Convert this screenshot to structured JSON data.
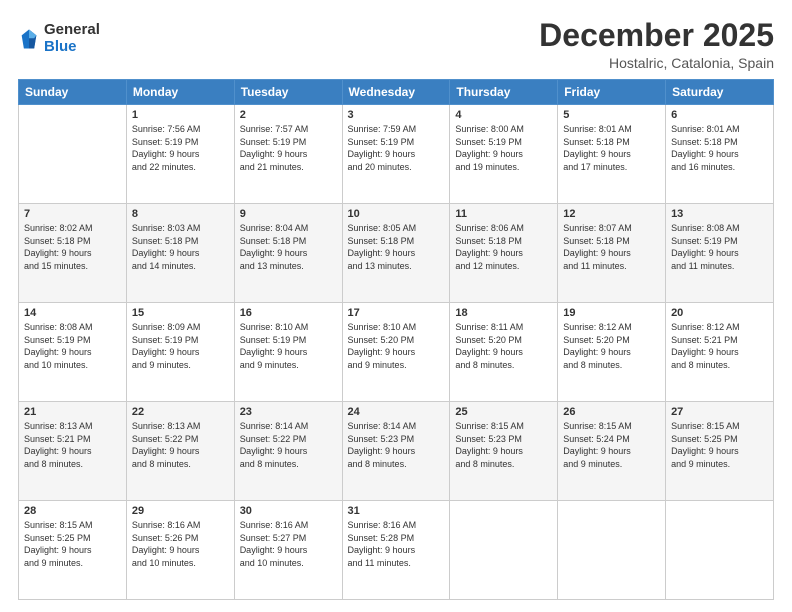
{
  "logo": {
    "line1": "General",
    "line2": "Blue"
  },
  "header": {
    "month": "December 2025",
    "location": "Hostalric, Catalonia, Spain"
  },
  "weekdays": [
    "Sunday",
    "Monday",
    "Tuesday",
    "Wednesday",
    "Thursday",
    "Friday",
    "Saturday"
  ],
  "weeks": [
    [
      {
        "day": "",
        "info": ""
      },
      {
        "day": "1",
        "info": "Sunrise: 7:56 AM\nSunset: 5:19 PM\nDaylight: 9 hours\nand 22 minutes."
      },
      {
        "day": "2",
        "info": "Sunrise: 7:57 AM\nSunset: 5:19 PM\nDaylight: 9 hours\nand 21 minutes."
      },
      {
        "day": "3",
        "info": "Sunrise: 7:59 AM\nSunset: 5:19 PM\nDaylight: 9 hours\nand 20 minutes."
      },
      {
        "day": "4",
        "info": "Sunrise: 8:00 AM\nSunset: 5:19 PM\nDaylight: 9 hours\nand 19 minutes."
      },
      {
        "day": "5",
        "info": "Sunrise: 8:01 AM\nSunset: 5:18 PM\nDaylight: 9 hours\nand 17 minutes."
      },
      {
        "day": "6",
        "info": "Sunrise: 8:01 AM\nSunset: 5:18 PM\nDaylight: 9 hours\nand 16 minutes."
      }
    ],
    [
      {
        "day": "7",
        "info": "Sunrise: 8:02 AM\nSunset: 5:18 PM\nDaylight: 9 hours\nand 15 minutes."
      },
      {
        "day": "8",
        "info": "Sunrise: 8:03 AM\nSunset: 5:18 PM\nDaylight: 9 hours\nand 14 minutes."
      },
      {
        "day": "9",
        "info": "Sunrise: 8:04 AM\nSunset: 5:18 PM\nDaylight: 9 hours\nand 13 minutes."
      },
      {
        "day": "10",
        "info": "Sunrise: 8:05 AM\nSunset: 5:18 PM\nDaylight: 9 hours\nand 13 minutes."
      },
      {
        "day": "11",
        "info": "Sunrise: 8:06 AM\nSunset: 5:18 PM\nDaylight: 9 hours\nand 12 minutes."
      },
      {
        "day": "12",
        "info": "Sunrise: 8:07 AM\nSunset: 5:18 PM\nDaylight: 9 hours\nand 11 minutes."
      },
      {
        "day": "13",
        "info": "Sunrise: 8:08 AM\nSunset: 5:19 PM\nDaylight: 9 hours\nand 11 minutes."
      }
    ],
    [
      {
        "day": "14",
        "info": "Sunrise: 8:08 AM\nSunset: 5:19 PM\nDaylight: 9 hours\nand 10 minutes."
      },
      {
        "day": "15",
        "info": "Sunrise: 8:09 AM\nSunset: 5:19 PM\nDaylight: 9 hours\nand 9 minutes."
      },
      {
        "day": "16",
        "info": "Sunrise: 8:10 AM\nSunset: 5:19 PM\nDaylight: 9 hours\nand 9 minutes."
      },
      {
        "day": "17",
        "info": "Sunrise: 8:10 AM\nSunset: 5:20 PM\nDaylight: 9 hours\nand 9 minutes."
      },
      {
        "day": "18",
        "info": "Sunrise: 8:11 AM\nSunset: 5:20 PM\nDaylight: 9 hours\nand 8 minutes."
      },
      {
        "day": "19",
        "info": "Sunrise: 8:12 AM\nSunset: 5:20 PM\nDaylight: 9 hours\nand 8 minutes."
      },
      {
        "day": "20",
        "info": "Sunrise: 8:12 AM\nSunset: 5:21 PM\nDaylight: 9 hours\nand 8 minutes."
      }
    ],
    [
      {
        "day": "21",
        "info": "Sunrise: 8:13 AM\nSunset: 5:21 PM\nDaylight: 9 hours\nand 8 minutes."
      },
      {
        "day": "22",
        "info": "Sunrise: 8:13 AM\nSunset: 5:22 PM\nDaylight: 9 hours\nand 8 minutes."
      },
      {
        "day": "23",
        "info": "Sunrise: 8:14 AM\nSunset: 5:22 PM\nDaylight: 9 hours\nand 8 minutes."
      },
      {
        "day": "24",
        "info": "Sunrise: 8:14 AM\nSunset: 5:23 PM\nDaylight: 9 hours\nand 8 minutes."
      },
      {
        "day": "25",
        "info": "Sunrise: 8:15 AM\nSunset: 5:23 PM\nDaylight: 9 hours\nand 8 minutes."
      },
      {
        "day": "26",
        "info": "Sunrise: 8:15 AM\nSunset: 5:24 PM\nDaylight: 9 hours\nand 9 minutes."
      },
      {
        "day": "27",
        "info": "Sunrise: 8:15 AM\nSunset: 5:25 PM\nDaylight: 9 hours\nand 9 minutes."
      }
    ],
    [
      {
        "day": "28",
        "info": "Sunrise: 8:15 AM\nSunset: 5:25 PM\nDaylight: 9 hours\nand 9 minutes."
      },
      {
        "day": "29",
        "info": "Sunrise: 8:16 AM\nSunset: 5:26 PM\nDaylight: 9 hours\nand 10 minutes."
      },
      {
        "day": "30",
        "info": "Sunrise: 8:16 AM\nSunset: 5:27 PM\nDaylight: 9 hours\nand 10 minutes."
      },
      {
        "day": "31",
        "info": "Sunrise: 8:16 AM\nSunset: 5:28 PM\nDaylight: 9 hours\nand 11 minutes."
      },
      {
        "day": "",
        "info": ""
      },
      {
        "day": "",
        "info": ""
      },
      {
        "day": "",
        "info": ""
      }
    ]
  ]
}
